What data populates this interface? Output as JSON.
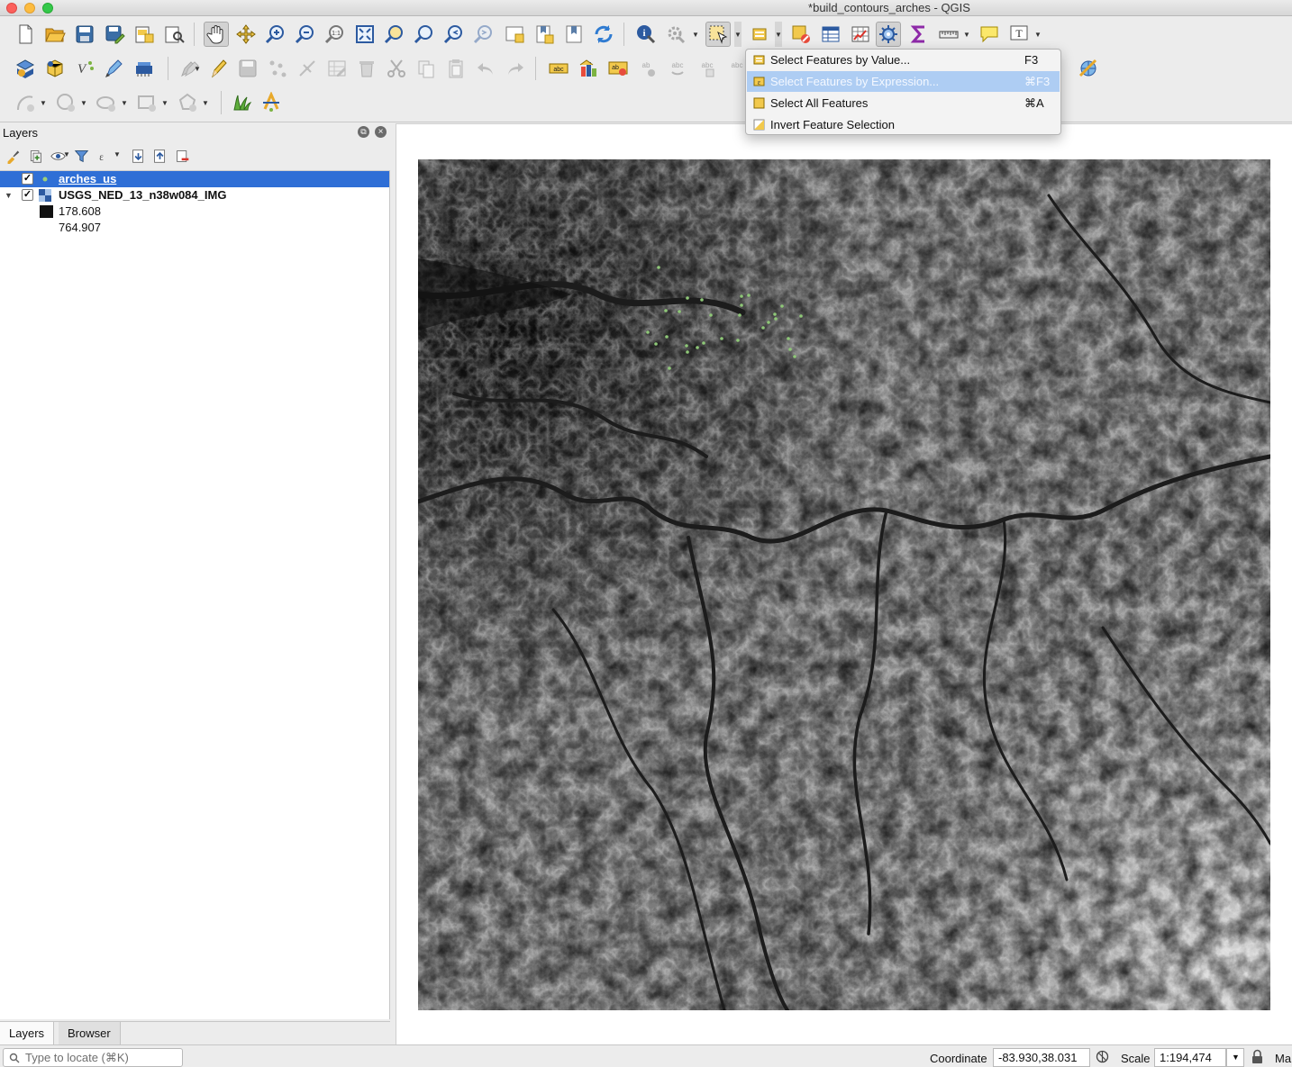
{
  "window": {
    "title": "*build_contours_arches - QGIS"
  },
  "toolbars": {
    "row1": [
      "new-project-icon",
      "open-project-icon",
      "save-project-icon",
      "save-as-icon",
      "new-print-layout-icon",
      "layout-manager-icon",
      "pan-icon",
      "pan-to-selection-icon",
      "zoom-in-icon",
      "zoom-out-icon",
      "zoom-native-icon",
      "zoom-full-icon",
      "zoom-to-selection-icon",
      "zoom-to-layer-icon",
      "zoom-last-icon",
      "zoom-next-icon",
      "new-map-view-icon",
      "new-bookmark-icon",
      "show-bookmarks-icon",
      "refresh-icon",
      "identify-icon",
      "action-icon",
      "select-features-icon",
      "select-by-value-icon",
      "deselect-icon",
      "attribute-table-icon",
      "field-calculator-icon",
      "processing-toolbox-icon",
      "statistics-icon",
      "measure-icon",
      "map-tips-icon",
      "text-annotation-icon"
    ],
    "row2": [
      "data-source-manager-icon",
      "new-geopackage-icon",
      "new-virtual-layer-icon",
      "digitize-icon",
      "new-temp-layer-icon",
      "current-edits-icon",
      "toggle-editing-icon",
      "save-edits-icon",
      "add-feature-icon",
      "vertex-tool-icon",
      "modify-attributes-icon",
      "delete-selected-icon",
      "cut-features-icon",
      "copy-features-icon",
      "paste-features-icon",
      "undo-icon",
      "redo-icon",
      "label-toolbar-icon",
      "diagram-icon",
      "pin-labels-icon",
      "show-hide-labels-icon",
      "move-label-icon",
      "rotate-label-icon",
      "change-label-icon",
      "georeferencer-icon"
    ],
    "row3": [
      "add-circular-string-icon",
      "add-circle-icon",
      "add-ellipse-icon",
      "add-rectangle-icon",
      "add-regular-polygon-icon",
      "grass-icon",
      "qgis2web-icon"
    ]
  },
  "layers_panel": {
    "title": "Layers",
    "layers": [
      {
        "name": "arches_us",
        "checked": true,
        "selected": true,
        "type": "point"
      },
      {
        "name": "USGS_NED_13_n38w084_IMG",
        "checked": true,
        "selected": false,
        "type": "raster",
        "expanded": true,
        "legend": [
          {
            "value": "178.608",
            "color": "#111111"
          },
          {
            "value": "764.907",
            "color": "#ffffff"
          }
        ]
      }
    ]
  },
  "bottom_tabs": [
    "Layers",
    "Browser"
  ],
  "selection_menu": {
    "items": [
      {
        "label": "Select Features by Value...",
        "shortcut": "F3",
        "highlighted": false
      },
      {
        "label": "Select Features by Expression...",
        "shortcut": "⌘F3",
        "highlighted": true
      },
      {
        "label": "Select All Features",
        "shortcut": "⌘A",
        "highlighted": false
      },
      {
        "label": "Invert Feature Selection",
        "shortcut": "",
        "highlighted": false
      }
    ]
  },
  "statusbar": {
    "locate_placeholder": "Type to locate (⌘K)",
    "coordinate_label": "Coordinate",
    "coordinate_value": "-83.930,38.031",
    "scale_label": "Scale",
    "scale_value": "1:194,474",
    "magnifier_label": "Ma"
  },
  "colors": {
    "selection_blue": "#2f6fd6",
    "menu_highlight": "#aecdf3",
    "arch_point": "#8fc878"
  }
}
